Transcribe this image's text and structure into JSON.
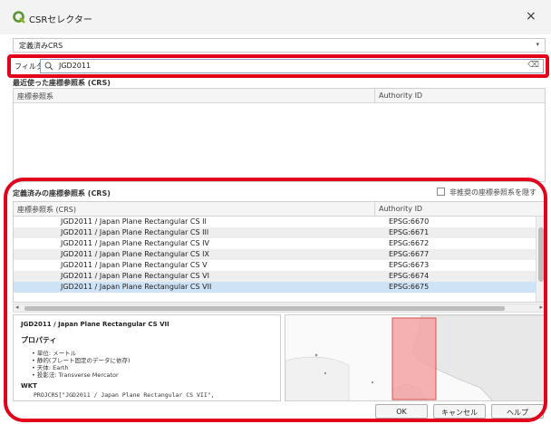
{
  "window": {
    "title": "CSRセレクター",
    "close_glyph": "×"
  },
  "crs_select": {
    "value": "定義済みCRS",
    "arrow": "▾"
  },
  "filter": {
    "label": "フィルタ",
    "value": "JGD2011",
    "clear_glyph": "⌫"
  },
  "recent": {
    "section_label": "最近使った座標参照系 (CRS)",
    "columns": [
      "座標参照系",
      "Authority ID"
    ]
  },
  "predefined": {
    "section_label": "定義済みの座標参照系 (CRS)",
    "hide_deprecated_label": "非推奨の座標参照系を隠す",
    "columns": [
      "座標参照系 (CRS)",
      "Authority ID"
    ],
    "rows": [
      {
        "name": "JGD2011 / Japan Plane Rectangular CS II",
        "auth": "EPSG:6670"
      },
      {
        "name": "JGD2011 / Japan Plane Rectangular CS III",
        "auth": "EPSG:6671"
      },
      {
        "name": "JGD2011 / Japan Plane Rectangular CS IV",
        "auth": "EPSG:6672"
      },
      {
        "name": "JGD2011 / Japan Plane Rectangular CS IX",
        "auth": "EPSG:6677"
      },
      {
        "name": "JGD2011 / Japan Plane Rectangular CS V",
        "auth": "EPSG:6673"
      },
      {
        "name": "JGD2011 / Japan Plane Rectangular CS VI",
        "auth": "EPSG:6674"
      },
      {
        "name": "JGD2011 / Japan Plane Rectangular CS VII",
        "auth": "EPSG:6675"
      }
    ],
    "selected_row": 6
  },
  "details": {
    "title": "JGD2011 / Japan Plane Rectangular CS VII",
    "properties_label": "プロパティ",
    "items": [
      "単位: メートル",
      "静的(プレート固定のデータに依存)",
      "天体: Earth",
      "投影法: Transverse Mercator"
    ],
    "wkt_label": "WKT",
    "wkt_text": "PROJCRS[\"JGD2011 / Japan Plane Rectangular CS VII\","
  },
  "buttons": {
    "ok": "OK",
    "cancel": "キャンセル",
    "help": "ヘルプ"
  },
  "colors": {
    "highlight": "#e3001b",
    "row_alt": "#eeeeee",
    "row_selected": "#cfe3f7",
    "map_extent": "#f3a3a3"
  }
}
